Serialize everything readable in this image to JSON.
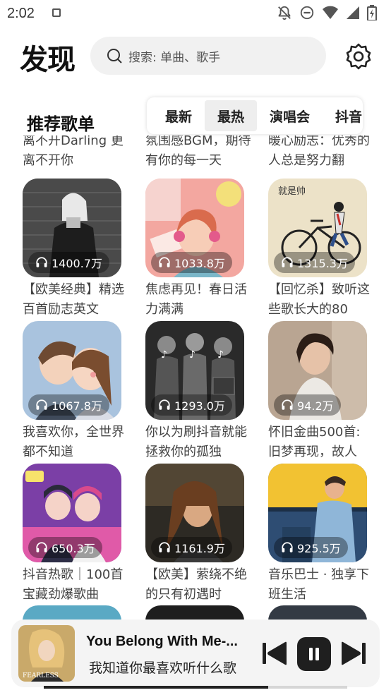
{
  "status_bar": {
    "time": "2:02"
  },
  "header": {
    "title": "发现",
    "search_placeholder": "搜索: 单曲、歌手"
  },
  "section": {
    "title": "推荐歌单",
    "tabs": [
      {
        "label": "最新",
        "active": false
      },
      {
        "label": "最热",
        "active": true
      },
      {
        "label": "演唱会",
        "active": false
      },
      {
        "label": "抖音",
        "active": false
      }
    ]
  },
  "partial_row": [
    {
      "caption": "离不开Darling 更离不开你"
    },
    {
      "caption": "氛围感BGM，期待有你的每一天"
    },
    {
      "caption": "暖心励志：优秀的人总是努力翻"
    }
  ],
  "playlists": [
    {
      "count": "1400.7万",
      "caption": "【欧美经典】精选百首励志英文"
    },
    {
      "count": "1033.8万",
      "caption": "焦虑再见！春日活力满满"
    },
    {
      "count": "1315.3万",
      "caption": "【回忆杀】致听这些歌长大的80"
    },
    {
      "count": "1067.8万",
      "caption": "我喜欢你，全世界都不知道"
    },
    {
      "count": "1293.0万",
      "caption": "你以为刷抖音就能拯救你的孤独"
    },
    {
      "count": "94.2万",
      "caption": "怀旧金曲500首:旧梦再现，故人"
    },
    {
      "count": "650.3万",
      "caption": "抖音热歌｜100首宝藏劲爆歌曲"
    },
    {
      "count": "1161.9万",
      "caption": "【欧美】萦绕不绝的只有初遇时"
    },
    {
      "count": "925.5万",
      "caption": "音乐巴士 · 独享下班生活"
    }
  ],
  "cover_text": {
    "calligraphy": "就是帅",
    "album": "FEARLESS"
  },
  "player": {
    "title": "You Belong With Me-...",
    "subtitle": "我知道你最喜欢听什么歌",
    "progress": 0.74
  },
  "colors": {
    "search_bg": "#f1f1f1",
    "player_bg": "#f4f4f4",
    "caption_text": "#444444"
  }
}
